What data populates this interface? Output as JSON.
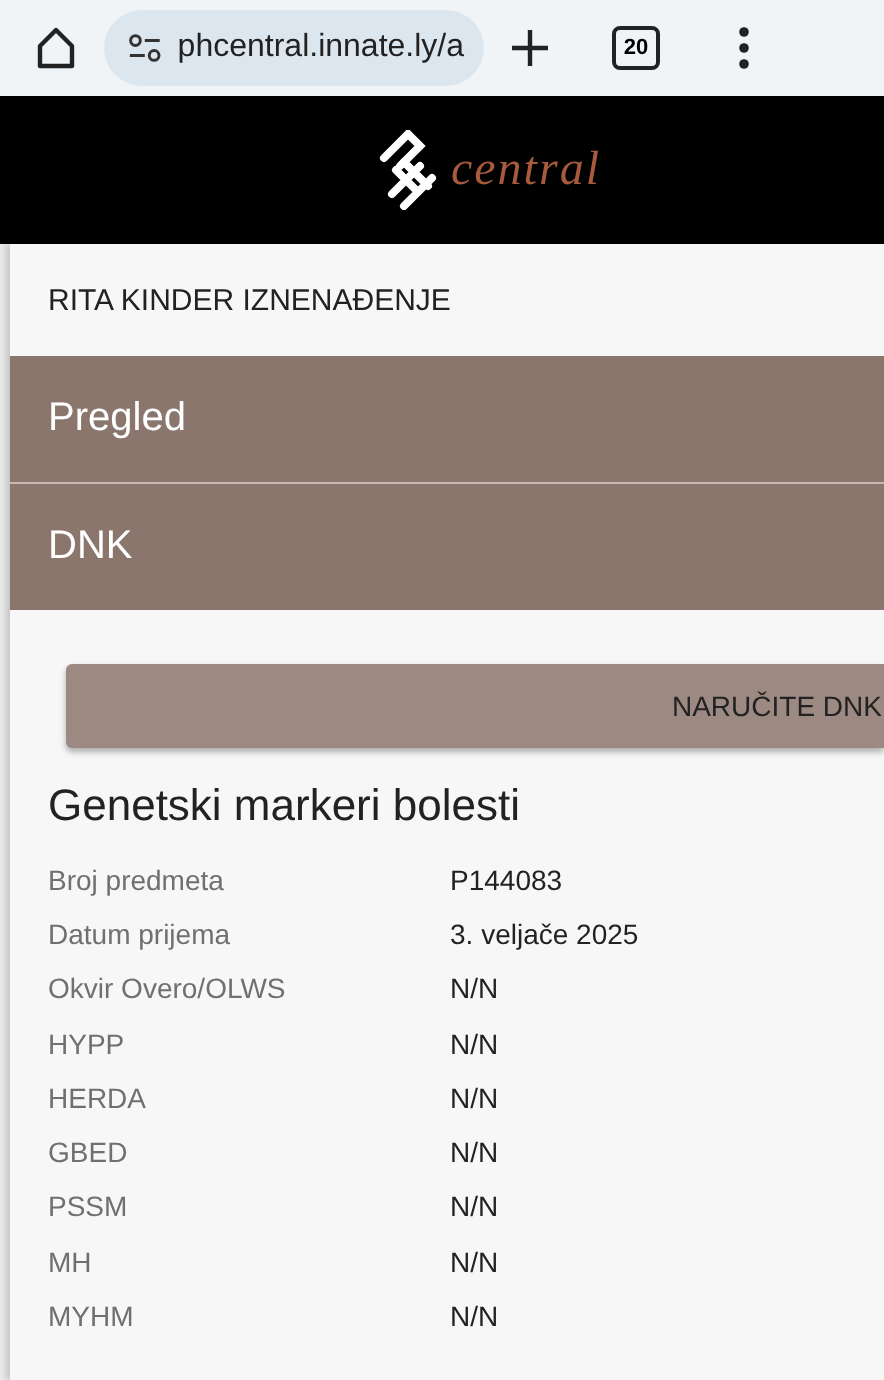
{
  "browser": {
    "url": "phcentral.innate.ly/a",
    "tab_count": "20"
  },
  "header": {
    "logo_text": "central"
  },
  "title": "RITA KINDER IZNENAĐENJE",
  "sections": [
    {
      "label": "Pregled"
    },
    {
      "label": "DNK"
    }
  ],
  "order_button": "NARUČITE DNK",
  "heading": "Genetski markeri bolesti",
  "rows": [
    {
      "label": "Broj predmeta",
      "value": "P144083"
    },
    {
      "label": "Datum prijema",
      "value": "3. veljače 2025"
    },
    {
      "label": "Okvir Overo/OLWS",
      "value": "N/N"
    },
    {
      "label": "HYPP",
      "value": "N/N"
    },
    {
      "label": "HERDA",
      "value": "N/N"
    },
    {
      "label": "GBED",
      "value": "N/N"
    },
    {
      "label": "PSSM",
      "value": "N/N"
    },
    {
      "label": "MH",
      "value": "N/N"
    },
    {
      "label": "MYHM",
      "value": "N/N"
    }
  ]
}
